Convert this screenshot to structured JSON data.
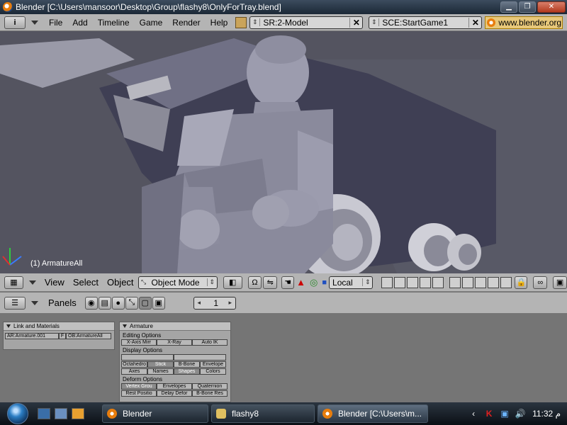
{
  "window": {
    "title": "Blender [C:\\Users\\mansoor\\Desktop\\Group\\flashy8\\OnlyForTray.blend]"
  },
  "menubar": {
    "info_icon": "i",
    "items": [
      "File",
      "Add",
      "Timeline",
      "Game",
      "Render",
      "Help"
    ],
    "screen_field": "SR:2-Model",
    "scene_field": "SCE:StartGame1",
    "url": "www.blender.org"
  },
  "viewport": {
    "object_label": "(1) ArmatureAll"
  },
  "view_header": {
    "items": [
      "View",
      "Select",
      "Object"
    ],
    "mode": "Object Mode",
    "transform_orientation": "Local"
  },
  "buttons_header": {
    "panels_label": "Panels",
    "frame": "1"
  },
  "link_materials": {
    "title": "Link and Materials",
    "armature_field": "AR:Armature.001",
    "f_label": "F",
    "object_field": "OB:ArmatureAll"
  },
  "armature_panel": {
    "title": "Armature",
    "editing_label": "Editing Options",
    "editing_buttons": [
      "X-Axis Mirr",
      "X-Ray",
      "Auto IK"
    ],
    "display_label": "Display Options",
    "display_row1": [
      "Octahedro",
      "Stick",
      "B-Bone",
      "Envelope"
    ],
    "display_row2": [
      "Axes",
      "Names",
      "Shapes",
      "Colors"
    ],
    "deform_label": "Deform Options",
    "deform_row1": [
      "Vertex Grou",
      "Envelopes",
      "Quaternion"
    ],
    "deform_row2": [
      "Rest Positio",
      "Delay Defor",
      "B-Bone Res"
    ]
  },
  "taskbar": {
    "tasks": [
      "Blender",
      "flashy8",
      "Blender [C:\\Users\\m..."
    ],
    "clock": "11:32 م"
  },
  "colors": {
    "viewport_bg": "#545460",
    "header_bg": "#b4b4b4",
    "panel_bg": "#757575"
  }
}
